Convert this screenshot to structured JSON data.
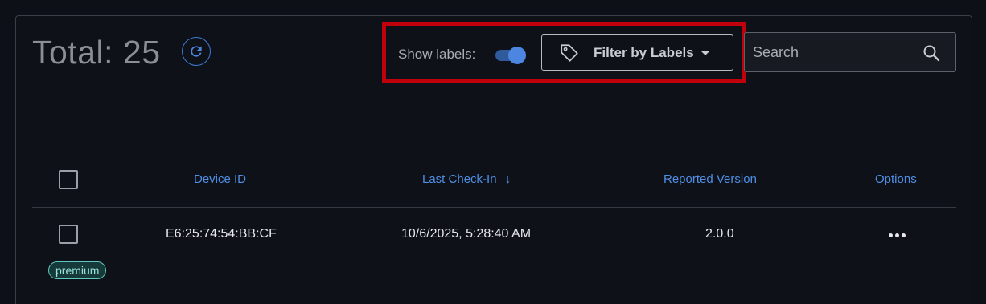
{
  "header": {
    "total_text": "Total: 25",
    "refresh_icon": "refresh-icon"
  },
  "toolbar": {
    "show_labels_text": "Show labels:",
    "show_labels_enabled": true,
    "filter_label": "Filter by Labels",
    "filter_icon": "tag-icon",
    "search_placeholder": "Search",
    "search_value": "",
    "search_icon": "search-icon"
  },
  "table": {
    "columns": [
      {
        "label": "Device ID"
      },
      {
        "label": "Last Check-In",
        "sort": "descending"
      },
      {
        "label": "Reported Version"
      },
      {
        "label": "Options"
      }
    ],
    "sort_arrow": "↓",
    "rows": [
      {
        "device_id": "E6:25:74:54:BB:CF",
        "last_check_in": "10/6/2025, 5:28:40 AM",
        "reported_version": "2.0.0",
        "options_icon": "more-horizontal-icon",
        "labels": [
          "premium"
        ]
      }
    ]
  },
  "colors": {
    "accent": "#4f8fe6",
    "highlight": "#c0000a",
    "badge_border": "#5fc8c0",
    "background": "#0d1017"
  }
}
